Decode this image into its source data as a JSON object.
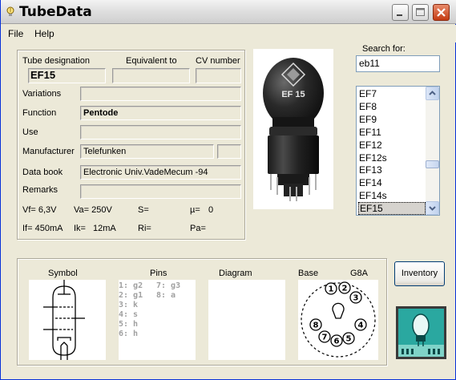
{
  "window": {
    "title": "TubeData"
  },
  "menu": {
    "file": "File",
    "help": "Help"
  },
  "info": {
    "col_designation": "Tube designation",
    "col_equivalent": "Equivalent to",
    "col_cv": "CV number",
    "designation": "EF15",
    "equivalent": "",
    "cv_number": "",
    "variations_label": "Variations",
    "variations": "",
    "function_label": "Function",
    "function": "Pentode",
    "use_label": "Use",
    "use": "",
    "manufacturer_label": "Manufacturer",
    "manufacturer": "Telefunken",
    "manufacturer_extra": "",
    "databook_label": "Data book",
    "databook": "Electronic Univ.VadeMecum -94",
    "remarks_label": "Remarks",
    "remarks": ""
  },
  "params": {
    "vf": "Vf= 6,3V",
    "va": "Va= 250V",
    "s": "S=",
    "mu": "µ=",
    "mu_val": "0",
    "if": "If= 450mA",
    "ik": "Ik=",
    "ik_val": "12mA",
    "ri": "Ri=",
    "pa": "Pa="
  },
  "search": {
    "label": "Search for:",
    "value": "eb11"
  },
  "tube_list": {
    "items": [
      "EF7",
      "EF8",
      "EF9",
      "EF11",
      "EF12",
      "EF12s",
      "EF13",
      "EF14",
      "EF14s",
      "EF15"
    ],
    "selected": "EF15"
  },
  "photo": {
    "print_line1": "EF 15"
  },
  "bottom": {
    "symbol_label": "Symbol",
    "pins_label": "Pins",
    "diagram_label": "Diagram",
    "base_label": "Base",
    "base_type": "G8A",
    "pins_left": [
      "1: g2",
      "2: g1",
      "3: k",
      "4: s",
      "5: h",
      "6: h"
    ],
    "pins_right": [
      "7: g3",
      "8: a"
    ],
    "base_pins": [
      "1",
      "2",
      "3",
      "4",
      "5",
      "6",
      "7",
      "8"
    ]
  },
  "buttons": {
    "inventory": "Inventory"
  },
  "icons": [
    "app-bulb-icon",
    "minimize-icon",
    "maximize-icon",
    "close-icon",
    "scroll-up-icon",
    "scroll-down-icon",
    "tube-book-icon"
  ],
  "colors": {
    "title_close": "#c43b13",
    "window_bg": "#ece9d8",
    "pins_text": "#a0a0a0",
    "book_teal": "#2aa8a0"
  }
}
